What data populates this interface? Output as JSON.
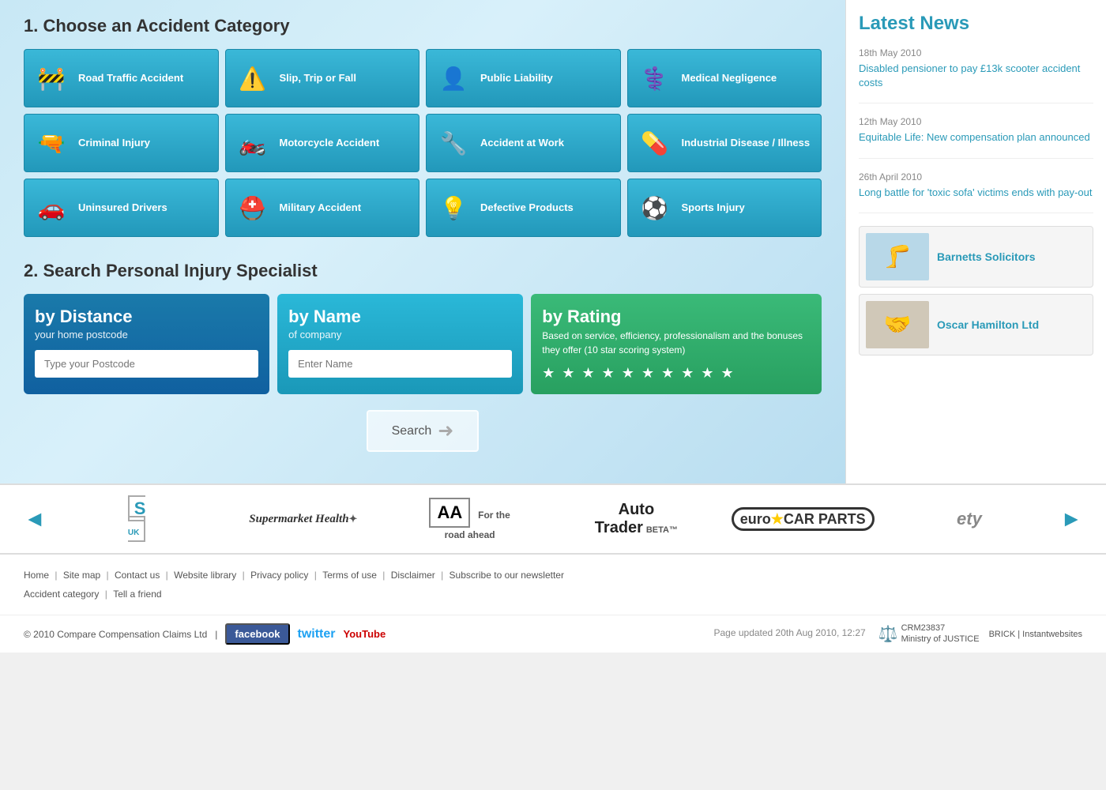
{
  "page": {
    "title": "Compare Compensation Claims"
  },
  "section1": {
    "title": "1. Choose an Accident Category"
  },
  "categories": [
    {
      "id": "road-traffic",
      "label": "Road Traffic Accident",
      "icon": "🚧"
    },
    {
      "id": "slip-trip",
      "label": "Slip, Trip or Fall",
      "icon": "⚠️"
    },
    {
      "id": "public-liability",
      "label": "Public Liability",
      "icon": "👤"
    },
    {
      "id": "medical-negligence",
      "label": "Medical Negligence",
      "icon": "⚕️"
    },
    {
      "id": "criminal-injury",
      "label": "Criminal Injury",
      "icon": "🔫"
    },
    {
      "id": "motorcycle",
      "label": "Motorcycle Accident",
      "icon": "🏍️"
    },
    {
      "id": "accident-work",
      "label": "Accident at Work",
      "icon": "🔧"
    },
    {
      "id": "industrial-disease",
      "label": "Industrial Disease / Illness",
      "icon": "💊"
    },
    {
      "id": "uninsured-drivers",
      "label": "Uninsured Drivers",
      "icon": "🚗"
    },
    {
      "id": "military",
      "label": "Military Accident",
      "icon": "⛑️"
    },
    {
      "id": "defective-products",
      "label": "Defective Products",
      "icon": "💡"
    },
    {
      "id": "sports-injury",
      "label": "Sports Injury",
      "icon": "⚽"
    }
  ],
  "section2": {
    "title": "2. Search Personal Injury Specialist"
  },
  "searchBoxes": {
    "distance": {
      "title": "by Distance",
      "subtitle": "your home postcode",
      "placeholder": "Type your Postcode"
    },
    "name": {
      "title": "by Name",
      "subtitle": "of company",
      "placeholder": "Enter Name"
    },
    "rating": {
      "title": "by Rating",
      "description": "Based on service, efficiency, professionalism and the bonuses they offer (10 star scoring system)",
      "stars": "★ ★ ★ ★ ★ ★ ★ ★ ★ ★"
    }
  },
  "searchButton": {
    "label": "Search"
  },
  "sidebar": {
    "title": "Latest News",
    "news": [
      {
        "date": "18th May 2010",
        "text": "Disabled pensioner to pay £13k scooter accident costs"
      },
      {
        "date": "12th May 2010",
        "text": "Equitable Life: New compensation plan announced"
      },
      {
        "date": "26th April 2010",
        "text": "Long battle for 'toxic sofa' victims ends with pay-out"
      }
    ],
    "ads": [
      {
        "name": "Barnetts Solicitors"
      },
      {
        "name": "Oscar Hamilton Ltd"
      }
    ]
  },
  "partners": {
    "items": [
      {
        "name": "S UK",
        "style": "plain"
      },
      {
        "name": "Supermarket Health",
        "style": "text"
      },
      {
        "name": "AA For the road ahead",
        "style": "boxed"
      },
      {
        "name": "Auto Trader BETA™",
        "style": "text"
      },
      {
        "name": "Euro Car Parts",
        "style": "text"
      },
      {
        "name": "ety",
        "style": "plain"
      }
    ]
  },
  "footer": {
    "links": [
      "Home",
      "Site map",
      "Contact us",
      "Website library",
      "Privacy policy",
      "Terms of use",
      "Disclaimer",
      "Subscribe to our newsletter",
      "Accident category",
      "Tell a friend"
    ],
    "copyright": "© 2010 Compare Compensation Claims Ltd",
    "pageUpdated": "Page updated 20th Aug 2010, 12:27",
    "social": {
      "facebook": "facebook",
      "twitter": "twitter",
      "youtube": "You"
    },
    "logos": {
      "ministryOfJustice": "Ministry of JUSTICE",
      "crm": "CRM23837",
      "brick": "BRICK | Instantwebsites"
    }
  }
}
